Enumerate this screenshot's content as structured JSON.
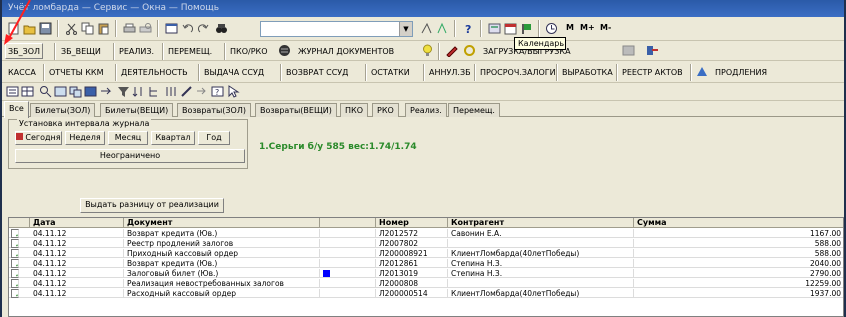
{
  "window": {
    "title": "Учёт ломбарда — Сервис — Окна — Помощь"
  },
  "toolbar1": {
    "combo_value": "",
    "tooltip": "Календарь",
    "mplus_labels": [
      "M",
      "M+",
      "M-"
    ]
  },
  "toolbar2": {
    "buttons": [
      "ЗБ_ЗОЛ",
      "ЗБ_ВЕЩИ",
      "РЕАЛИЗ.",
      "ПЕРЕМЕЩ.",
      "ПКО/РКО",
      "ЖУРНАЛ ДОКУМЕНТОВ",
      "ЗАГРУЗКА/ВЫГРУЗКА"
    ]
  },
  "toolbar3": {
    "buttons": [
      "КАССА",
      "ОТЧЕТЫ ККМ",
      "ДЕЯТЕЛЬНОСТЬ",
      "ВЫДАЧА ССУД",
      "ВОЗВРАТ ССУД",
      "ОСТАТКИ",
      "АННУЛ.ЗБ",
      "ПРОСРОЧ.ЗАЛОГИ",
      "ВЫРАБОТКА",
      "РЕЕСТР АКТОВ",
      "ПРОДЛЕНИЯ"
    ]
  },
  "tabs": [
    "Все",
    "Билеты(ЗОЛ)",
    "Билеты(ВЕЩИ)",
    "Возвраты(ЗОЛ)",
    "Возвраты(ВЕЩИ)",
    "ПКО",
    "РКО",
    "Реализ.",
    "Перемещ."
  ],
  "interval": {
    "legend": "Установка интервала журнала",
    "buttons": [
      "Сегодня",
      "Неделя",
      "Месяц",
      "Квартал",
      "Год"
    ],
    "unlimited": "Неограничено"
  },
  "info_text": "1.Серьги б/у 585 вес:1.74/1.74",
  "diff_button": "Выдать разницу от реализации",
  "grid": {
    "columns": [
      "Дата",
      "Документ",
      "",
      "Номер",
      "Контрагент",
      "Сумма"
    ],
    "rows": [
      {
        "date": "04.11.12",
        "doc": "Возврат кредита (Юв.)",
        "num": "Л2012572",
        "agent": "Савонин Е.А.",
        "sum": "1167.00",
        "mark": false
      },
      {
        "date": "04.11.12",
        "doc": "Реестр продлений залогов",
        "num": "Л2007802",
        "agent": "",
        "sum": "588.00",
        "mark": false
      },
      {
        "date": "04.11.12",
        "doc": "Приходный кассовый ордер",
        "num": "Л200008921",
        "agent": "КлиентЛомбарда(40летПобеды)",
        "sum": "588.00",
        "mark": false
      },
      {
        "date": "04.11.12",
        "doc": "Возврат кредита (Юв.)",
        "num": "Л2012861",
        "agent": "Степина Н.З.",
        "sum": "2040.00",
        "mark": false
      },
      {
        "date": "04.11.12",
        "doc": "Залоговый билет (Юв.)",
        "num": "Л2013019",
        "agent": "Степина Н.З.",
        "sum": "2790.00",
        "mark": true
      },
      {
        "date": "04.11.12",
        "doc": "Реализация невостребованных залогов",
        "num": "Л2000808",
        "agent": "",
        "sum": "12259.00",
        "mark": false
      },
      {
        "date": "04.11.12",
        "doc": "Расходный кассовый ордер",
        "num": "Л200000514",
        "agent": "КлиентЛомбарда(40летПобеды)",
        "sum": "1937.00",
        "mark": false
      }
    ]
  },
  "colors": {
    "accent_arrow": "#ff2020",
    "mark": "#0000ff",
    "info": "#2a8a2a"
  }
}
